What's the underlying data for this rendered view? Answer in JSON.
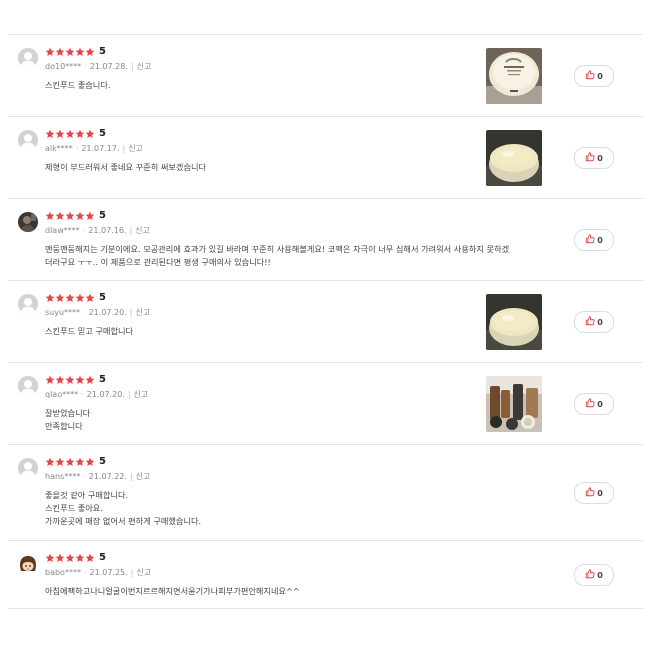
{
  "reviews": [
    {
      "rating": 5,
      "score": "5",
      "user": "do10****",
      "date": "21.07.28.",
      "report": "신고",
      "lines": [
        "스킨푸드 좋습니다."
      ],
      "has_photo": true,
      "photo": "jar-lid",
      "likes": "0",
      "avatar": "default"
    },
    {
      "rating": 5,
      "score": "5",
      "user": "alk****",
      "date": "21.07.17.",
      "report": "신고",
      "lines": [
        "제형이 부드러워서 좋네요 꾸준히 써보겠습니다"
      ],
      "has_photo": true,
      "photo": "jar-open",
      "likes": "0",
      "avatar": "default"
    },
    {
      "rating": 5,
      "score": "5",
      "user": "dlaw****",
      "date": "21.07.16.",
      "report": "신고",
      "lines": [
        "맨둥맨둥해지는 기분이에요. 모공관리에 효과가 있길 바라며 꾸준히 사용해볼게요! 코팩은 자극이 너무 심해서 가려워서 사용하지 못하겠",
        "더라구요 ㅜㅜ.. 이 제품으로 관리된다면 평생 구매의사 있습니다!!"
      ],
      "has_photo": false,
      "likes": "0",
      "avatar": "photo"
    },
    {
      "rating": 5,
      "score": "5",
      "user": "suyu****",
      "date": "21.07.20.",
      "report": "신고",
      "lines": [
        "스킨푸드 믿고 구매합니다"
      ],
      "has_photo": true,
      "photo": "jar-open",
      "likes": "0",
      "avatar": "default"
    },
    {
      "rating": 5,
      "score": "5",
      "user": "qlao****",
      "date": "21.07.20.",
      "report": "신고",
      "lines": [
        "잘받았습니다",
        "만족합니다"
      ],
      "has_photo": true,
      "photo": "bottles",
      "likes": "0",
      "avatar": "default"
    },
    {
      "rating": 5,
      "score": "5",
      "user": "hans****",
      "date": "21.07.22.",
      "report": "신고",
      "lines": [
        "좋을것 같아 구매합니다.",
        "스킨푸드 좋아요.",
        "가까운곳에 매장 없어서 편하게 구매했습니다."
      ],
      "has_photo": false,
      "likes": "0",
      "avatar": "default"
    },
    {
      "rating": 5,
      "score": "5",
      "user": "babo****",
      "date": "21.07.25.",
      "report": "신고",
      "lines": [
        "아침에팩하고나니얼굴이번지르르해지면서윤기가나피부가편안해지네요^^"
      ],
      "has_photo": false,
      "likes": "0",
      "avatar": "cartoon"
    }
  ],
  "colors": {
    "star": "#e2474b",
    "like_icon": "#e2474b",
    "divider": "#e3e3e3"
  }
}
